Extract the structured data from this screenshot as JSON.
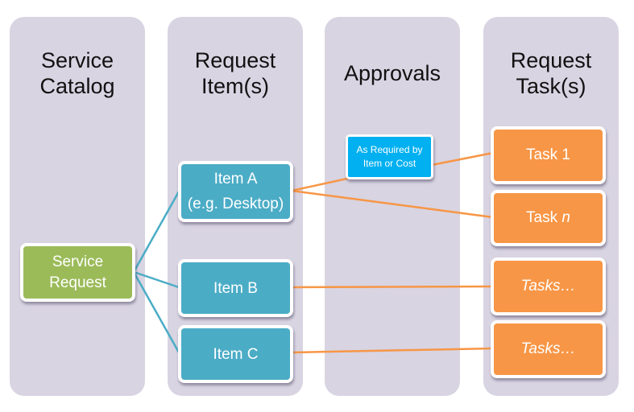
{
  "columns": [
    {
      "id": "service-catalog",
      "title_lines": [
        "Service",
        "Catalog"
      ]
    },
    {
      "id": "request-items",
      "title_lines": [
        "Request",
        "Item(s)"
      ]
    },
    {
      "id": "approvals",
      "title_lines": [
        "Approvals"
      ]
    },
    {
      "id": "request-tasks",
      "title_lines": [
        "Request",
        "Task(s)"
      ]
    }
  ],
  "nodes": {
    "service_request": {
      "lines": [
        "Service",
        "Request"
      ],
      "color": "#9bbb59"
    },
    "item_a": {
      "lines": [
        "Item A",
        "(e.g. Desktop)"
      ],
      "color": "#4bacc6"
    },
    "item_b": {
      "lines": [
        "Item B"
      ],
      "color": "#4bacc6"
    },
    "item_c": {
      "lines": [
        "Item C"
      ],
      "color": "#4bacc6"
    },
    "approval": {
      "lines": [
        "As Required by",
        "Item or Cost"
      ],
      "color": "#00b0f0"
    },
    "task_1": {
      "label": "Task 1",
      "color": "#f79646"
    },
    "task_n": {
      "prefix": "Task ",
      "italic": "n",
      "color": "#f79646"
    },
    "tasks_b": {
      "label": "Tasks…",
      "color": "#f79646"
    },
    "tasks_c": {
      "label": "Tasks…",
      "color": "#f79646"
    }
  },
  "connections": [
    {
      "from": "service_request",
      "to": "item_a",
      "color": "#4bacc6"
    },
    {
      "from": "service_request",
      "to": "item_b",
      "color": "#4bacc6"
    },
    {
      "from": "service_request",
      "to": "item_c",
      "color": "#4bacc6"
    },
    {
      "from": "item_a",
      "to": "approval",
      "color": "#f79646"
    },
    {
      "from": "approval",
      "to": "task_1",
      "color": "#f79646"
    },
    {
      "from": "item_a",
      "to": "task_n",
      "color": "#f79646"
    },
    {
      "from": "item_b",
      "to": "tasks_b",
      "color": "#f79646"
    },
    {
      "from": "item_c",
      "to": "tasks_c",
      "color": "#f79646"
    }
  ]
}
